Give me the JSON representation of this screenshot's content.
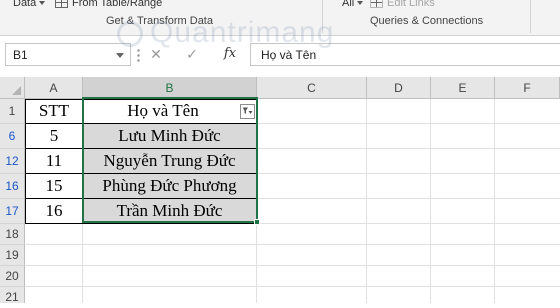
{
  "ribbon": {
    "data_label": "Data",
    "from_table_label": "From Table/Range",
    "all_label": "All",
    "edit_links_label": "Edit Links",
    "group_get_transform": "Get & Transform Data",
    "group_queries": "Queries & Connections"
  },
  "formula_bar": {
    "name_box": "B1",
    "cancel_icon": "✕",
    "enter_icon": "✓",
    "fx_label": "fx",
    "content": "Họ và Tên"
  },
  "watermark": "Quantrimang",
  "columns": [
    "A",
    "B",
    "C",
    "D",
    "E",
    "F"
  ],
  "rows": [
    "1",
    "6",
    "12",
    "16",
    "17",
    "18",
    "19",
    "20",
    "21"
  ],
  "table": {
    "header": {
      "stt": "STT",
      "name": "Họ và Tên"
    },
    "records": [
      {
        "stt": "5",
        "name": "Lưu Minh Đức"
      },
      {
        "stt": "11",
        "name": "Nguyễn Trung Đức"
      },
      {
        "stt": "15",
        "name": "Phùng Đức Phương"
      },
      {
        "stt": "16",
        "name": "Trần Minh Đức"
      }
    ]
  },
  "icons": {
    "filter": "filter-active-icon",
    "fx": "function-icon"
  },
  "colors": {
    "accent": "#217346",
    "filtered_row_number": "#1b56c8",
    "cell_shade": "#d9d9d9"
  }
}
